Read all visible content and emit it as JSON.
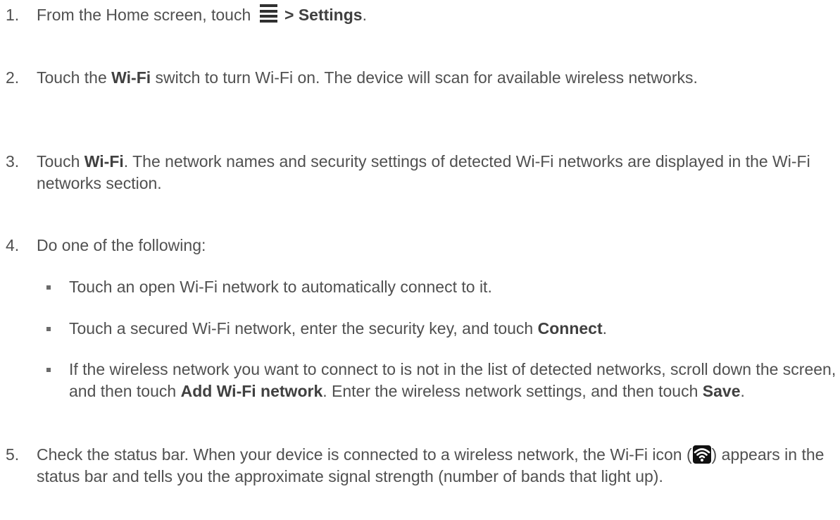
{
  "steps": [
    {
      "num": "1.",
      "pre": "From the Home screen, touch",
      "post": "> Settings",
      "end": "."
    },
    {
      "num": "2.",
      "pre": "Touch the ",
      "bold": "Wi-Fi",
      "post": " switch to turn Wi-Fi on. The device will scan for available wireless networks."
    },
    {
      "num": "3.",
      "pre": "Touch ",
      "bold": "Wi-Fi",
      "post": ". The network names and security settings of detected Wi-Fi networks are displayed in the Wi-Fi networks section."
    },
    {
      "num": "4.",
      "text": "Do one of the following:"
    },
    {
      "num": "5.",
      "pre": "Check the status bar. When your device is connected to a wireless network, the Wi-Fi icon (",
      "post": ") appears in the status bar and tells you the approximate signal strength (number of bands that light up)."
    }
  ],
  "bullets": [
    {
      "text": "Touch an open Wi-Fi network to automatically connect to it."
    },
    {
      "pre": "Touch a secured Wi-Fi network, enter the security key, and touch ",
      "bold": "Connect",
      "post": "."
    },
    {
      "pre": "If the wireless network you want to connect to is not in the list of detected networks, scroll down the screen, and then touch ",
      "bold": "Add Wi-Fi network",
      "mid": ". Enter the wireless network settings, and then touch ",
      "bold2": "Save",
      "post": "."
    }
  ],
  "icons": {
    "menu": "menu-icon",
    "wifi": "wifi-status-icon"
  },
  "colors": {
    "text": "#505050",
    "bold": "#404040",
    "bullet": "#6b6b6b"
  }
}
